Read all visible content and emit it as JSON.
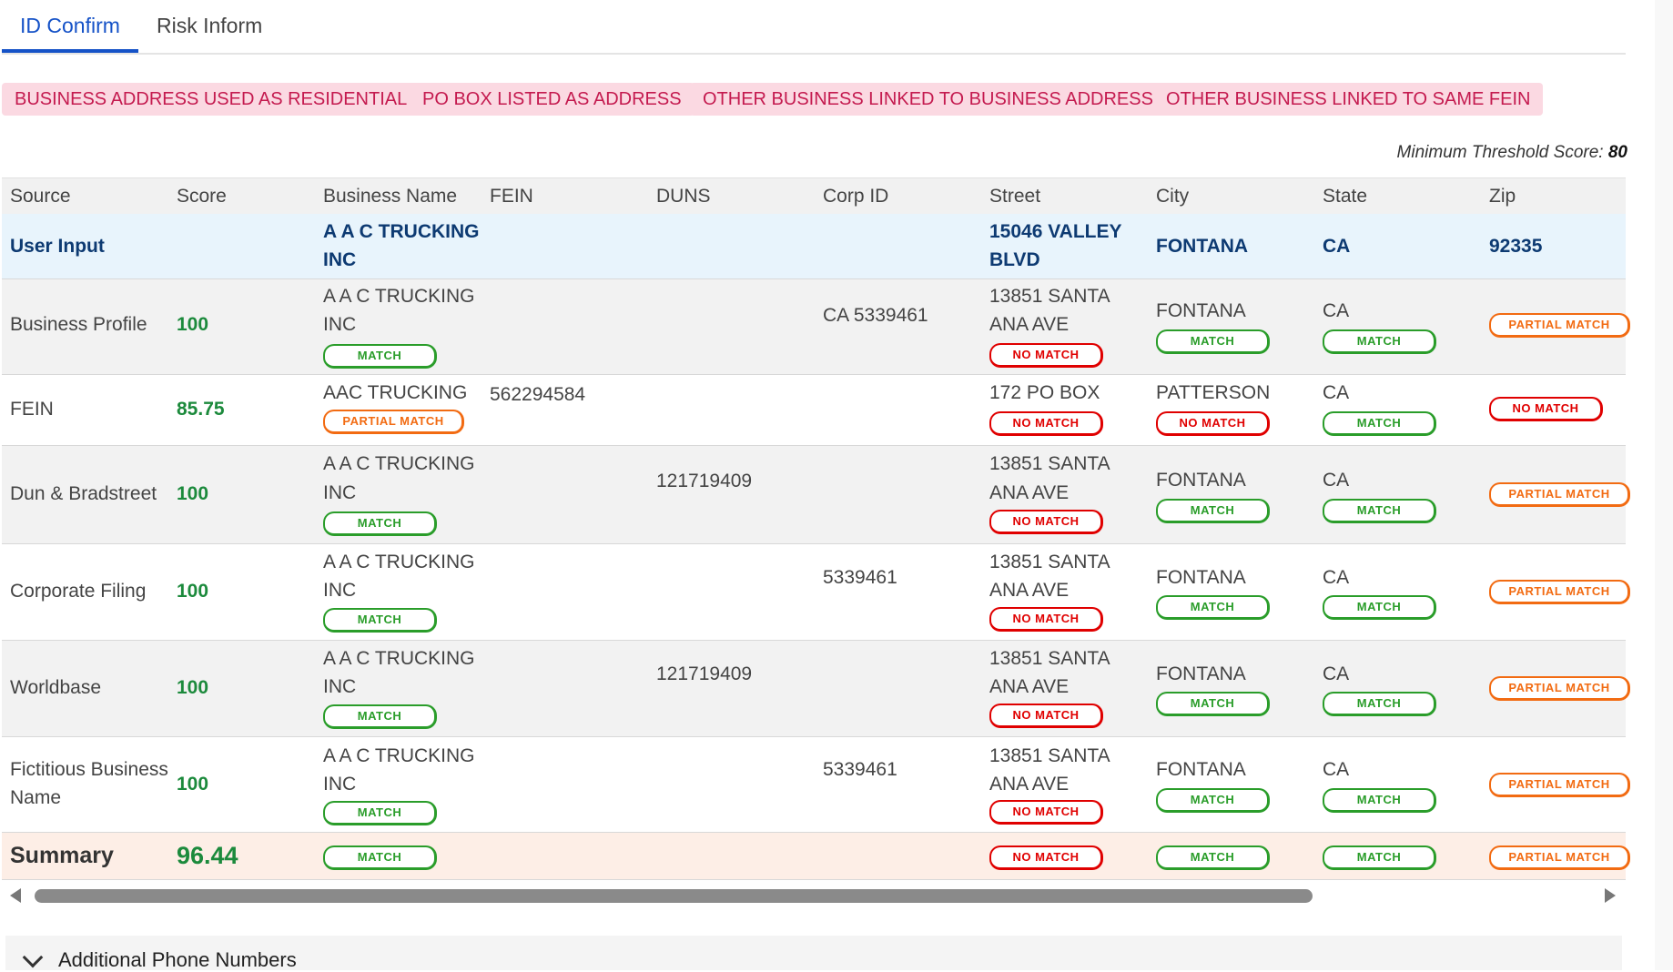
{
  "tabs": [
    {
      "label": "ID Confirm",
      "active": true
    },
    {
      "label": "Risk Inform",
      "active": false
    }
  ],
  "alerts": [
    "BUSINESS ADDRESS USED AS RESIDENTIAL",
    "PO BOX LISTED AS ADDRESS",
    "OTHER BUSINESS LINKED TO BUSINESS ADDRESS",
    "OTHER BUSINESS LINKED TO SAME FEIN"
  ],
  "threshold": {
    "label": "Minimum Threshold Score:",
    "value": "80"
  },
  "columns": [
    "Source",
    "Score",
    "Business Name",
    "FEIN",
    "DUNS",
    "Corp ID",
    "Street",
    "City",
    "State",
    "Zip"
  ],
  "user_input": {
    "source": "User Input",
    "business_name_1": "A A C TRUCKING",
    "business_name_2": "INC",
    "street_1": "15046 VALLEY",
    "street_2": "BLVD",
    "city": "FONTANA",
    "state": "CA",
    "zip": "92335"
  },
  "badges": {
    "match": "MATCH",
    "no_match": "NO MATCH",
    "partial": "PARTIAL MATCH"
  },
  "rows": [
    {
      "source": "Business Profile",
      "score": "100",
      "name1": "A A C TRUCKING",
      "name2": "INC",
      "fein": "",
      "duns": "",
      "corp_id": "CA 5339461",
      "street1": "13851 SANTA",
      "street2": "ANA AVE",
      "city": "FONTANA",
      "state": "CA"
    },
    {
      "source": "FEIN",
      "score": "85.75",
      "name1": "AAC TRUCKING",
      "name2": "",
      "fein": "562294584",
      "duns": "",
      "corp_id": "",
      "street1": "172 PO BOX",
      "street2": "",
      "city": "PATTERSON",
      "state": "CA"
    },
    {
      "source": "Dun & Bradstreet",
      "score": "100",
      "name1": "A A C TRUCKING",
      "name2": "INC",
      "fein": "",
      "duns": "121719409",
      "corp_id": "",
      "street1": "13851 SANTA",
      "street2": "ANA AVE",
      "city": "FONTANA",
      "state": "CA"
    },
    {
      "source": "Corporate Filing",
      "score": "100",
      "name1": "A A C TRUCKING",
      "name2": "INC",
      "fein": "",
      "duns": "",
      "corp_id": "5339461",
      "street1": "13851 SANTA",
      "street2": "ANA AVE",
      "city": "FONTANA",
      "state": "CA"
    },
    {
      "source": "Worldbase",
      "score": "100",
      "name1": "A A C TRUCKING",
      "name2": "INC",
      "fein": "",
      "duns": "121719409",
      "corp_id": "",
      "street1": "13851 SANTA",
      "street2": "ANA AVE",
      "city": "FONTANA",
      "state": "CA"
    },
    {
      "source_1": "Fictitious Business",
      "source_2": "Name",
      "score": "100",
      "name1": "A A C TRUCKING",
      "name2": "INC",
      "fein": "",
      "duns": "",
      "corp_id": "5339461",
      "street1": "13851 SANTA",
      "street2": "ANA AVE",
      "city": "FONTANA",
      "state": "CA"
    }
  ],
  "summary": {
    "source": "Summary",
    "score": "96.44"
  },
  "accordion": {
    "label": "Additional Phone Numbers"
  },
  "colors": {
    "accent": "#1552c7",
    "match": "#2a9d2a",
    "no_match": "#e00000",
    "partial": "#f26b12",
    "alert_bg": "#fbd9e2",
    "alert_text": "#c41a4f"
  }
}
